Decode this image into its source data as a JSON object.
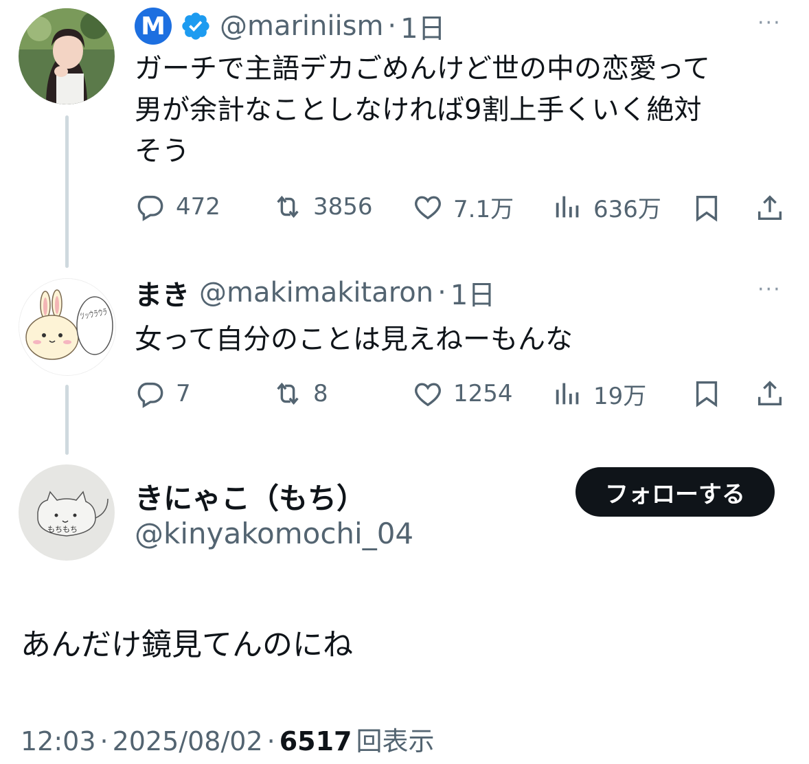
{
  "tweet1": {
    "badge_letter": "M",
    "handle": "@mariniism",
    "separator": "·",
    "time": "1日",
    "more": "···",
    "text_lines": [
      "ガーチで主語デカごめんけど世の中の恋愛って",
      "男が余計なことしなければ9割上手くいく絶対",
      "そう"
    ],
    "replies": "472",
    "retweets": "3856",
    "likes": "7.1万",
    "views": "636万"
  },
  "tweet2": {
    "name": "まき",
    "handle": "@makimakitaron",
    "separator": "·",
    "time": "1日",
    "more": "···",
    "avatar_text": "ツッウラウラ",
    "text": "女って自分のことは見えねーもんな",
    "replies": "7",
    "retweets": "8",
    "likes": "1254",
    "views": "19万"
  },
  "main_tweet": {
    "name": "きにゃこ（もち）",
    "handle": "@kinyakomochi_04",
    "follow_label": "フォローする",
    "avatar_text": "もちもち",
    "text": "あんだけ鏡見てんのにね",
    "time": "12:03",
    "sep1": "·",
    "date": "2025/08/02",
    "sep2": "·",
    "view_count": "6517",
    "view_label": "回表示"
  },
  "colors": {
    "text": "#0f1419",
    "secondary": "#536471",
    "verified": "#1d9bf0",
    "thread_line": "#cfd9de",
    "badge_bg": "#1d6fe0"
  }
}
